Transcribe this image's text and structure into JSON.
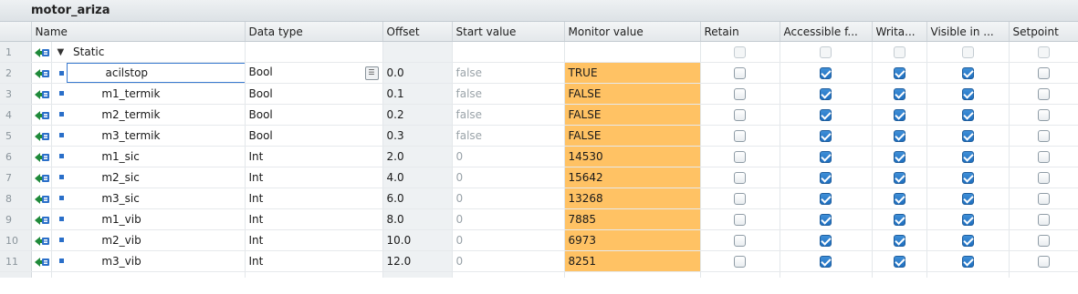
{
  "block_title": "motor_ariza",
  "columns": {
    "name": "Name",
    "data_type": "Data type",
    "offset": "Offset",
    "start_value": "Start value",
    "monitor_value": "Monitor value",
    "retain": "Retain",
    "accessible": "Accessible f...",
    "writable": "Writa...",
    "visible": "Visible in ...",
    "setpoint": "Setpoint"
  },
  "static_row": {
    "num": "1",
    "name": "Static"
  },
  "rows": [
    {
      "num": "2",
      "name": "acilstop",
      "type": "Bool",
      "offset": "0.0",
      "start": "false",
      "monitor": "TRUE"
    },
    {
      "num": "3",
      "name": "m1_termik",
      "type": "Bool",
      "offset": "0.1",
      "start": "false",
      "monitor": "FALSE"
    },
    {
      "num": "4",
      "name": "m2_termik",
      "type": "Bool",
      "offset": "0.2",
      "start": "false",
      "monitor": "FALSE"
    },
    {
      "num": "5",
      "name": "m3_termik",
      "type": "Bool",
      "offset": "0.3",
      "start": "false",
      "monitor": "FALSE"
    },
    {
      "num": "6",
      "name": "m1_sic",
      "type": "Int",
      "offset": "2.0",
      "start": "0",
      "monitor": "14530"
    },
    {
      "num": "7",
      "name": "m2_sic",
      "type": "Int",
      "offset": "4.0",
      "start": "0",
      "monitor": "15642"
    },
    {
      "num": "8",
      "name": "m3_sic",
      "type": "Int",
      "offset": "6.0",
      "start": "0",
      "monitor": "13268"
    },
    {
      "num": "9",
      "name": "m1_vib",
      "type": "Int",
      "offset": "8.0",
      "start": "0",
      "monitor": "7885"
    },
    {
      "num": "10",
      "name": "m2_vib",
      "type": "Int",
      "offset": "10.0",
      "start": "0",
      "monitor": "6973"
    },
    {
      "num": "11",
      "name": "m3_vib",
      "type": "Int",
      "offset": "12.0",
      "start": "0",
      "monitor": "8251"
    }
  ],
  "checkbox_states": {
    "retain": false,
    "accessible": true,
    "writable": true,
    "visible": true,
    "setpoint": false
  },
  "icons": {
    "interface": "interface-arrow-icon",
    "expand": "collapse-triangle-icon",
    "member": "member-bullet-icon",
    "type_picker": "type-picker-icon"
  },
  "colors": {
    "monitor_bg": "#ffc264",
    "checkbox_checked": "#1f6fbf",
    "selection_border": "#3b7bd0"
  }
}
